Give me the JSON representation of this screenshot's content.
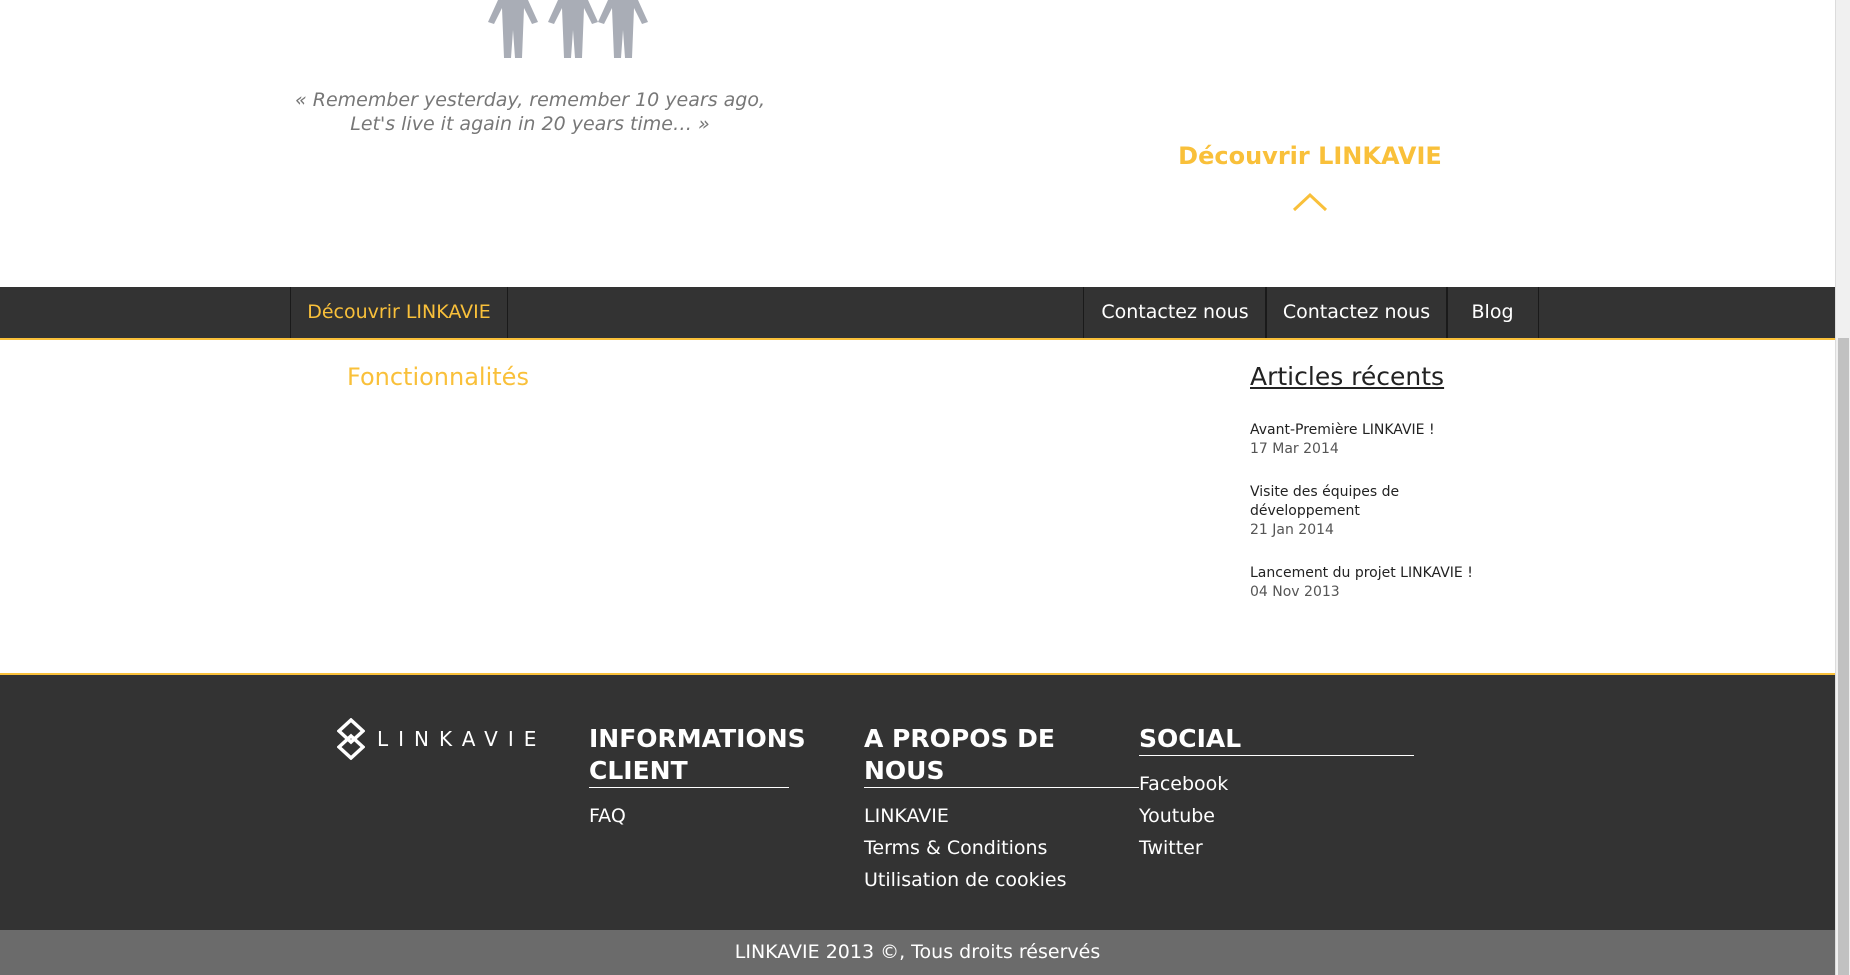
{
  "hero": {
    "quote_line_1": "« Remember yesterday, remember 10 years ago,",
    "quote_line_2": "Let's live it again in 20 years time… »",
    "discover_label": "Découvrir LINKAVIE"
  },
  "nav": {
    "items": [
      {
        "label": "Découvrir LINKAVIE"
      },
      {
        "label": "Contactez nous"
      },
      {
        "label": "Contactez nous"
      },
      {
        "label": "Blog"
      }
    ]
  },
  "main": {
    "section_title": "Fonctionnalités"
  },
  "sidebar": {
    "title": "Articles récents",
    "articles": [
      {
        "title": "Avant-Première LINKAVIE !",
        "date": "17 Mar 2014"
      },
      {
        "title": "Visite des équipes de développement",
        "date": "21 Jan 2014"
      },
      {
        "title": "Lancement du projet LINKAVIE !",
        "date": "04 Nov 2013"
      }
    ]
  },
  "footer": {
    "logo_text": "LINKAVIE",
    "columns": [
      {
        "title": "INFORMATIONS CLIENT",
        "links": [
          "FAQ"
        ]
      },
      {
        "title": "A PROPOS DE NOUS",
        "links": [
          "LINKAVIE",
          "Terms & Conditions",
          "Utilisation de cookies"
        ]
      },
      {
        "title": "SOCIAL",
        "links": [
          "Facebook",
          "Youtube",
          "Twitter"
        ]
      }
    ],
    "copyright": "LINKAVIE 2013 ©, Tous droits réservés"
  },
  "colors": {
    "accent": "#f9c03a",
    "dark": "#333333",
    "copyright_bg": "#6b6b6b"
  },
  "icons": {
    "people": "people-group-icon",
    "chevron": "chevron-up-icon",
    "logo": "linkavie-logo-icon"
  }
}
